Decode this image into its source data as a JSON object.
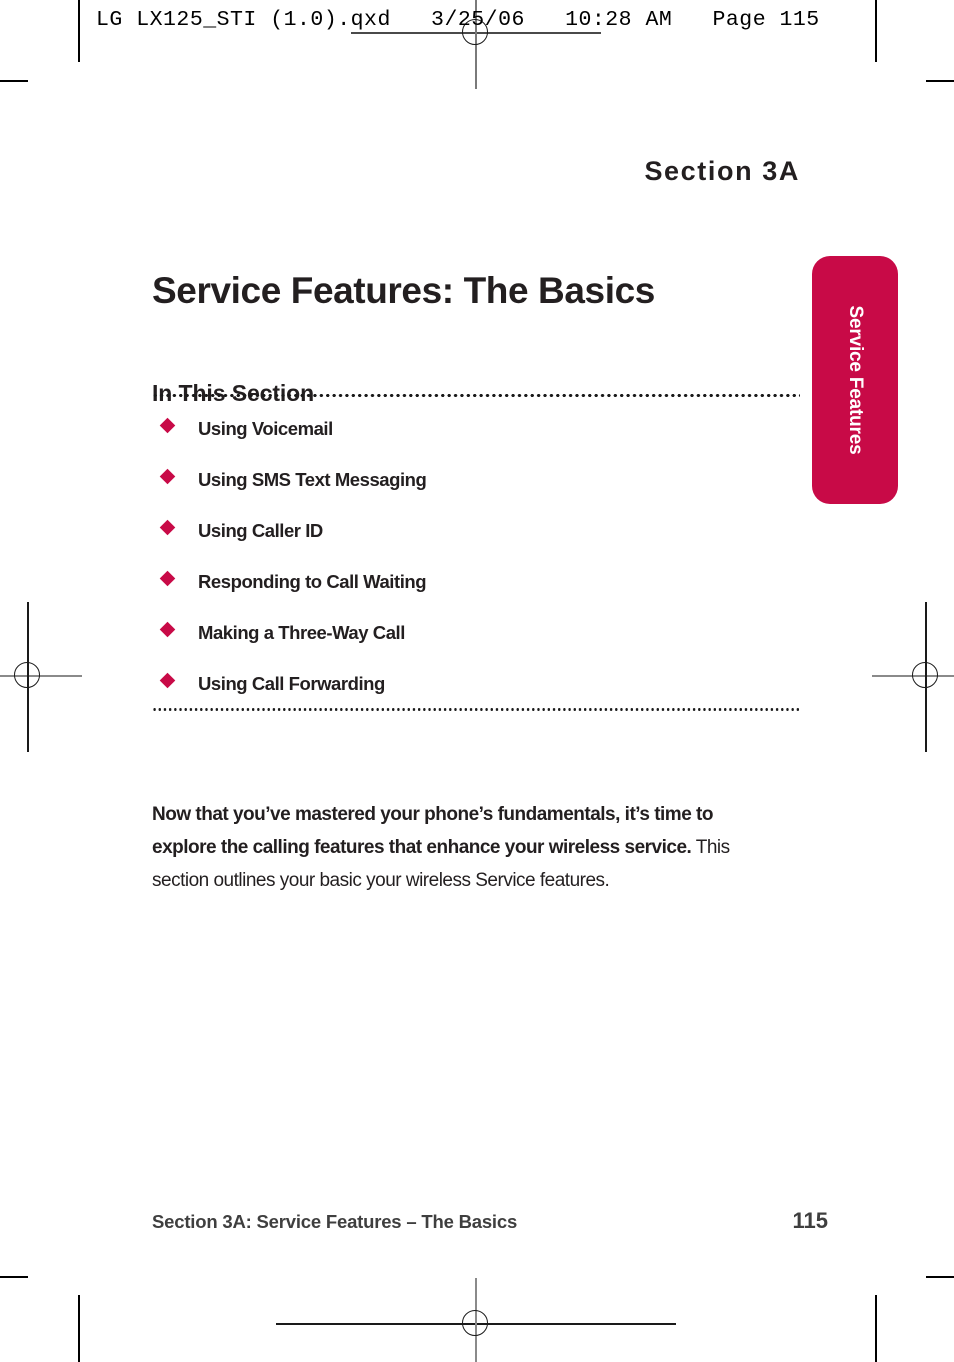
{
  "print_slug": {
    "text": "LG LX125_STI (1.0).qxd   3/25/06   10:28 AM   Page 115"
  },
  "header": {
    "section_label": "Section 3A",
    "title": "Service Features: The Basics"
  },
  "in_this_section": {
    "heading": "In This Section",
    "items": [
      {
        "label": "Using Voicemail"
      },
      {
        "label": "Using SMS Text Messaging"
      },
      {
        "label": "Using Caller ID"
      },
      {
        "label": "Responding to Call Waiting"
      },
      {
        "label": "Making a Three-Way Call"
      },
      {
        "label": "Using Call Forwarding"
      }
    ]
  },
  "intro": {
    "lead": "Now that you’ve mastered your phone’s fundamentals, it’s time to explore the calling features that enhance your wireless service.",
    "rest": " This section outlines your basic your wireless Service features."
  },
  "side_tab": {
    "label": "Service Features"
  },
  "footer": {
    "text": "Section 3A: Service Features – The Basics",
    "page_number": "115"
  },
  "colors": {
    "accent_crimson": "#c80a47",
    "text_dark": "#231f20",
    "footer_gray": "#3f3f3f"
  }
}
